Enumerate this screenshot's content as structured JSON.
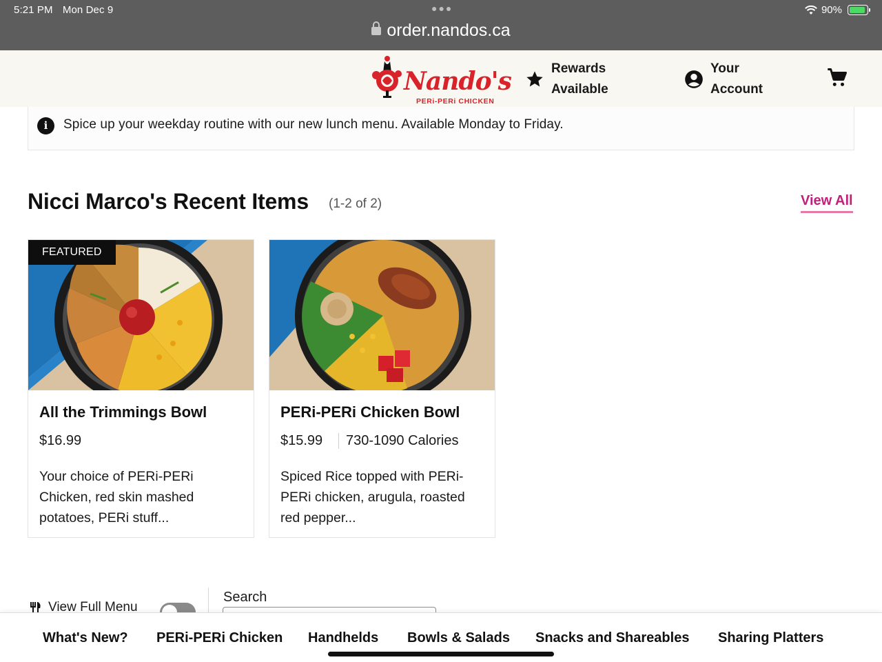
{
  "status_bar": {
    "time": "5:21 PM",
    "date": "Mon Dec 9",
    "battery": "90%",
    "url": "order.nandos.ca"
  },
  "header": {
    "logo_text": "Nando's",
    "logo_tagline": "PERi-PERi CHICKEN",
    "rewards_line1": "Rewards",
    "rewards_line2": "Available",
    "account_line1": "Your",
    "account_line2": "Account"
  },
  "notice": {
    "text": "Spice up your weekday routine with our new lunch menu. Available Monday to Friday."
  },
  "recent": {
    "title": "Nicci Marco's Recent Items",
    "count": "(1-2 of 2)",
    "view_all": "View All",
    "items": [
      {
        "badge": "FEATURED",
        "name": "All the Trimmings Bowl",
        "price": "$16.99",
        "calories": "",
        "description": "Your choice of PERi-PERi Chicken, red skin mashed potatoes, PERi stuff..."
      },
      {
        "badge": "",
        "name": "PERi-PERi Chicken Bowl",
        "price": "$15.99",
        "calories": "730-1090 Calories",
        "description": "Spiced Rice topped with PERi-PERi chicken, arugula, roasted red pepper..."
      }
    ]
  },
  "menu_controls": {
    "view_full_menu": "View Full Menu",
    "search_label": "Search"
  },
  "categories": [
    "What's New?",
    "PERi-PERi Chicken",
    "Handhelds",
    "Bowls & Salads",
    "Snacks and Shareables",
    "Sharing Platters"
  ],
  "colors": {
    "brand_red": "#d8232a",
    "link_pink": "#c0207a",
    "status_gray": "#5d5d5d",
    "header_cream": "#f9f7f2",
    "battery_green": "#4cd964"
  }
}
